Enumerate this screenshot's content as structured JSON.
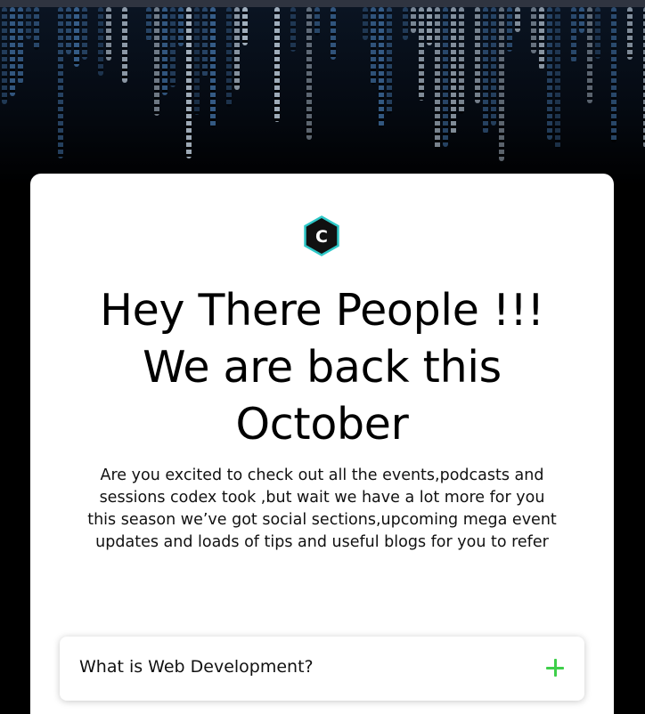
{
  "hero": {
    "logo_letter": "C",
    "title": "Hey There People !!! We are back this October",
    "description": "Are you excited to check out all the events,podcasts and sessions codex took ,but wait we have a lot more for you this season we’ve got social sections,upcoming mega event updates and loads of tips and useful blogs for you to refer"
  },
  "faq": {
    "items": [
      {
        "question": "What is Web Development?",
        "toggle_icon": "plus-icon"
      }
    ]
  },
  "colors": {
    "background": "#000000",
    "card": "#ffffff",
    "accent_plus": "#3ecf4a",
    "logo_fill": "#111111",
    "logo_outline": "#2ec8c8"
  }
}
